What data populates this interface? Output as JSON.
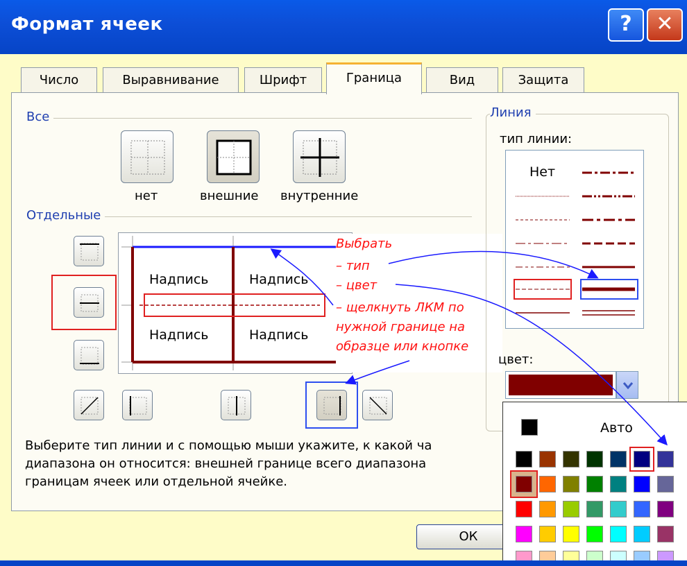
{
  "window": {
    "title": "Формат ячеек",
    "help_label": "?",
    "close_label": "✕"
  },
  "tabs": [
    {
      "label": "Число"
    },
    {
      "label": "Выравнивание"
    },
    {
      "label": "Шрифт"
    },
    {
      "label": "Граница",
      "active": true
    },
    {
      "label": "Вид"
    },
    {
      "label": "Защита"
    }
  ],
  "presets": {
    "group_label": "Все",
    "none_label": "нет",
    "outline_label": "внешние",
    "inside_label": "внутренние"
  },
  "border_group_label": "Отдельные",
  "preview": {
    "cell_label": "Надпись"
  },
  "annotation": {
    "lines": [
      "Выбрать",
      "– тип",
      "– цвет",
      "– щелкнуть ЛКМ по",
      "нужной границе на",
      "образце или кнопке"
    ]
  },
  "line": {
    "group_label": "Линия",
    "style_label": "тип линии:",
    "none_label": "Нет",
    "color_label": "цвет:",
    "selected_color": "#800000"
  },
  "palette": {
    "auto_label": "Авто",
    "auto_color": "#000000",
    "selected_color": "#800000",
    "rows": [
      [
        "#000000",
        "#993300",
        "#333300",
        "#003300",
        "#003366",
        "#000080",
        "#333399"
      ],
      [
        "#800000",
        "#ff6600",
        "#808000",
        "#008000",
        "#008080",
        "#0000ff",
        "#666699"
      ],
      [
        "#ff0000",
        "#ff9900",
        "#99cc00",
        "#339966",
        "#33cccc",
        "#3366ff",
        "#800080"
      ],
      [
        "#ff00ff",
        "#ffcc00",
        "#ffff00",
        "#00ff00",
        "#00ffff",
        "#00ccff",
        "#993366"
      ],
      [
        "#ff99cc",
        "#ffcc99",
        "#ffff99",
        "#ccffcc",
        "#ccffff",
        "#99ccff",
        "#cc99ff"
      ]
    ]
  },
  "description": {
    "line1": "Выберите тип линии и с помощью мыши укажите, к какой ча",
    "line2": "диапазона он относится: внешней границе всего диапазона",
    "line3": "границам ячеек или отдельной ячейке."
  },
  "buttons": {
    "ok_label": "ОК"
  }
}
